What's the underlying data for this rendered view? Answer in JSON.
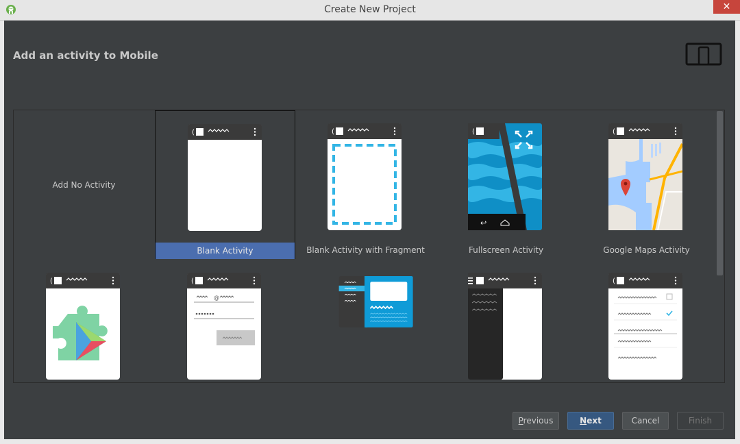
{
  "window": {
    "title": "Create New Project",
    "close_glyph": "✕"
  },
  "header": {
    "title": "Add an activity to Mobile",
    "form_factor_icon": "phone-tablet-icon"
  },
  "gallery": {
    "add_no_activity": "Add No Activity",
    "tiles": [
      {
        "label": "Blank Activity",
        "icon": "blank-activity-icon",
        "selected": true
      },
      {
        "label": "Blank Activity with Fragment",
        "icon": "blank-fragment-icon"
      },
      {
        "label": "Fullscreen Activity",
        "icon": "fullscreen-icon"
      },
      {
        "label": "Google Maps Activity",
        "icon": "maps-icon"
      },
      {
        "label": "",
        "icon": "play-services-icon"
      },
      {
        "label": "",
        "icon": "login-form-icon"
      },
      {
        "label": "",
        "icon": "master-detail-icon"
      },
      {
        "label": "",
        "icon": "navigation-drawer-icon"
      },
      {
        "label": "",
        "icon": "settings-list-icon"
      }
    ],
    "login_at": "@"
  },
  "buttons": {
    "previous_m": "P",
    "previous_rest": "revious",
    "next_m": "N",
    "next_rest": "ext",
    "cancel": "Cancel",
    "finish": "Finish"
  },
  "colors": {
    "background": "#3c3f41",
    "selection": "#4b6eaf",
    "primary_button": "#365880",
    "accent_blue": "#33b5e5"
  }
}
